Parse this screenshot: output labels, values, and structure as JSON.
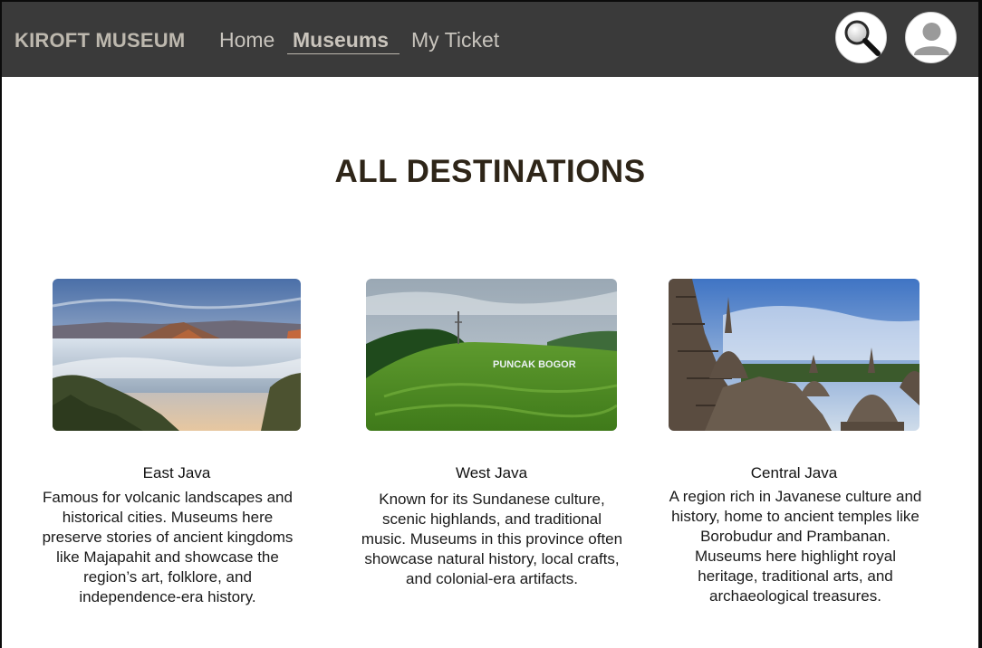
{
  "navbar": {
    "brand": "KIROFT MUSEUM",
    "links": [
      "Home",
      "Museums",
      "My Ticket"
    ],
    "active_link": "Museums",
    "search_icon": "magnifying-glass-icon",
    "profile_icon": "user-avatar-icon"
  },
  "page": {
    "title": "ALL DESTINATIONS"
  },
  "destinations": [
    {
      "name": "East Java",
      "image": "volcanic landscape photo",
      "description": "Famous for volcanic landscapes and historical cities. Museums here preserve stories of ancient kingdoms like Majapahit and showcase the region’s art, folklore, and independence-era history."
    },
    {
      "name": "West Java",
      "image": "green tea hills photo",
      "image_sign": "PUNCAK BOGOR",
      "description": "Known for its Sundanese culture, scenic highlands, and traditional music. Museums in this province often showcase natural history, local crafts, and colonial-era artifacts."
    },
    {
      "name": "Central Java",
      "image": "temple stupas photo",
      "description": "A region rich in Javanese culture and history, home to ancient temples like Borobudur and Prambanan. Museums here highlight royal heritage, traditional arts, and archaeological treasures."
    }
  ],
  "colors": {
    "navbar_bg": "#3a3a3a",
    "nav_text": "#c8c4bd",
    "title_text": "#2e2518",
    "page_bg": "#ffffff"
  }
}
